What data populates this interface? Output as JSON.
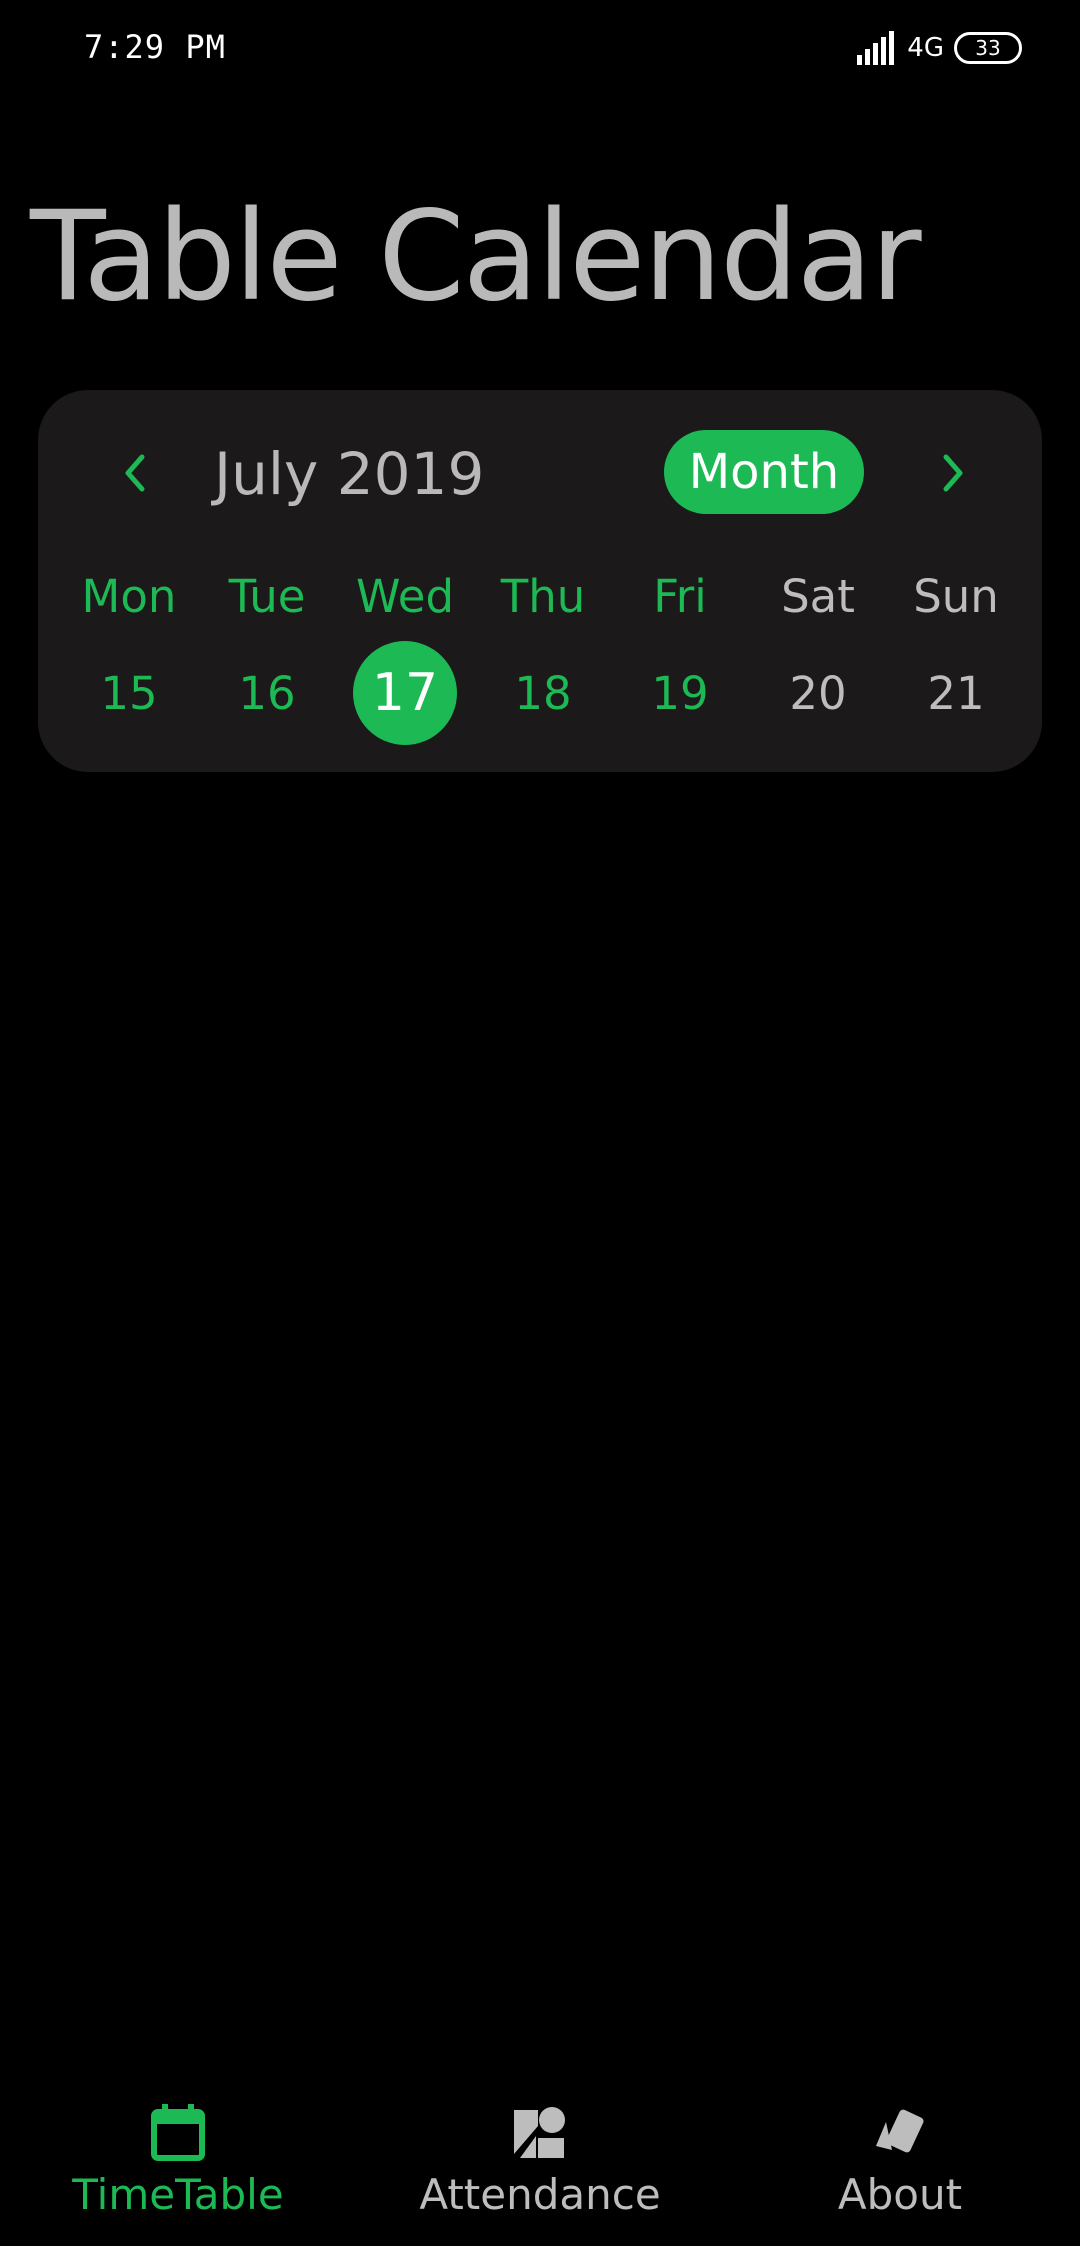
{
  "status_bar": {
    "time": "7:29 PM",
    "network": "4G",
    "battery": "33"
  },
  "title": "Table Calendar",
  "calendar": {
    "month_label": "July 2019",
    "format_button": "Month",
    "days_of_week": [
      "Mon",
      "Tue",
      "Wed",
      "Thu",
      "Fri",
      "Sat",
      "Sun"
    ],
    "days": [
      "15",
      "16",
      "17",
      "18",
      "19",
      "20",
      "21"
    ],
    "selected_day": "17",
    "colors": {
      "accent": "#1db954",
      "weekend": "#bdbdbd",
      "card": "#1b1919"
    }
  },
  "bottom_nav": {
    "items": [
      {
        "label": "TimeTable",
        "icon": "calendar-icon",
        "active": true
      },
      {
        "label": "Attendance",
        "icon": "attendance-icon",
        "active": false
      },
      {
        "label": "About",
        "icon": "cards-icon",
        "active": false
      }
    ]
  }
}
